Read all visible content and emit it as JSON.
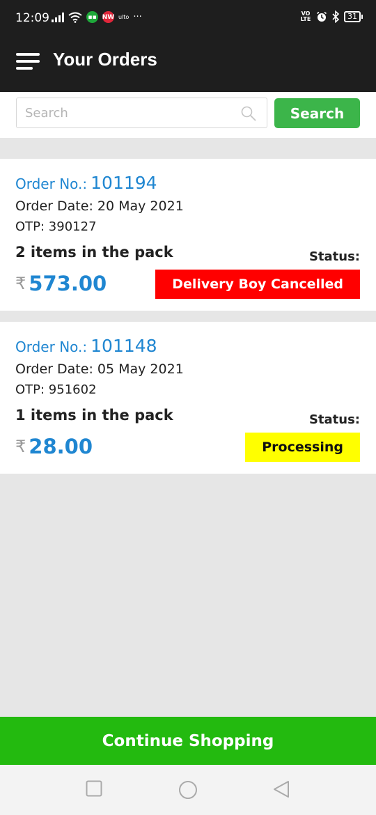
{
  "status_bar": {
    "time": "12:09",
    "app_badge_text": "ulto",
    "more": "···",
    "network": "VO LTE",
    "battery": "31"
  },
  "header": {
    "title": "Your Orders",
    "icon": "hamburger-menu-icon"
  },
  "search": {
    "placeholder": "Search",
    "value": "",
    "button_label": "Search"
  },
  "orders": [
    {
      "order_no_label": "Order No.:",
      "order_no": "101194",
      "order_date": "Order Date: 20 May 2021",
      "otp": "OTP: 390127",
      "items": "2 items in the pack",
      "status_label": "Status:",
      "currency": "₹",
      "price": "573.00",
      "status": "Delivery Boy Cancelled",
      "status_bg": "#ff0000",
      "status_color": "#ffffff"
    },
    {
      "order_no_label": "Order No.:",
      "order_no": "101148",
      "order_date": "Order Date: 05 May 2021",
      "otp": "OTP: 951602",
      "items": "1 items in the pack",
      "status_label": "Status:",
      "currency": "₹",
      "price": "28.00",
      "status": "Processing",
      "status_bg": "#ffff00",
      "status_color": "#111111"
    }
  ],
  "footer": {
    "continue_label": "Continue Shopping"
  },
  "colors": {
    "accent_blue": "#1f86d1",
    "search_green": "#3cb54a",
    "continue_green": "#23ba0f",
    "header_bg": "#1e1e1e"
  }
}
